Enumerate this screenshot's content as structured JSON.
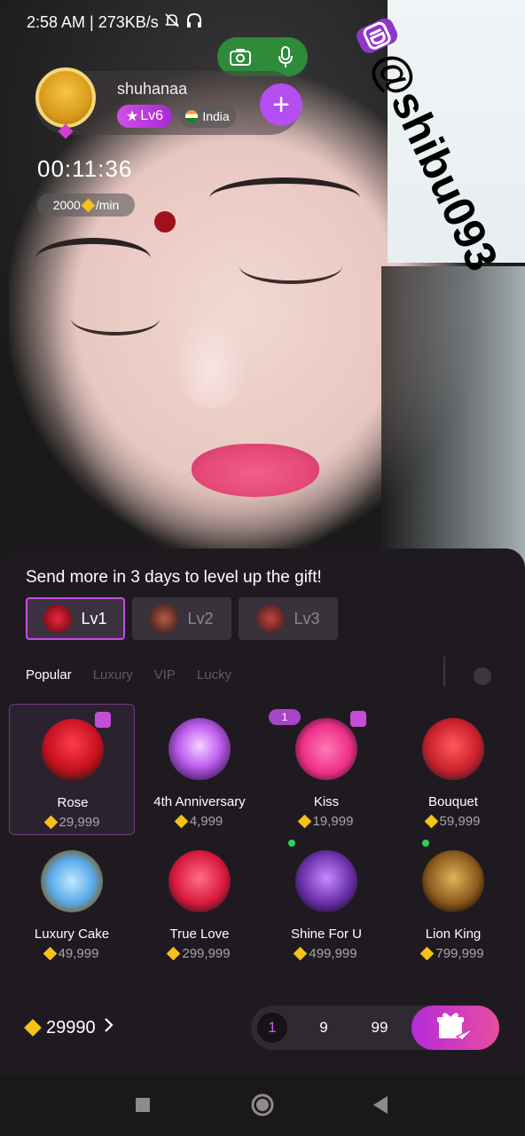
{
  "status_bar": {
    "time_speed": "2:58 AM | 273KB/s"
  },
  "watermark": {
    "handle": "@shibu093"
  },
  "host": {
    "name": "shuhanaa",
    "level": "Lv6",
    "country": "India",
    "timer": "00:11:36",
    "rate_value": "2000",
    "rate_unit": "/min"
  },
  "gift_panel": {
    "title": "Send more in 3 days to level up the gift!",
    "level_tabs": [
      "Lv1",
      "Lv2",
      "Lv3"
    ],
    "categories": [
      "Popular",
      "Luxury",
      "VIP",
      "Lucky"
    ],
    "gifts": [
      {
        "name": "Rose",
        "price": "29,999"
      },
      {
        "name": "4th Anniversary",
        "price": "4,999"
      },
      {
        "name": "Kiss",
        "price": "19,999"
      },
      {
        "name": "Bouquet",
        "price": "59,999"
      },
      {
        "name": "Luxury Cake",
        "price": "49,999"
      },
      {
        "name": "True Love",
        "price": "299,999"
      },
      {
        "name": "Shine For U",
        "price": "499,999"
      },
      {
        "name": "Lion King",
        "price": "799,999"
      }
    ],
    "kiss_badge": "1",
    "balance": "29990",
    "quantities": [
      "1",
      "9",
      "99"
    ]
  },
  "colors": {
    "accent_purple": "#b34ef0",
    "cam_green": "#2e8b3a",
    "panel_bg": "#1f1a20",
    "diamond_gold": "#f6c21a"
  }
}
